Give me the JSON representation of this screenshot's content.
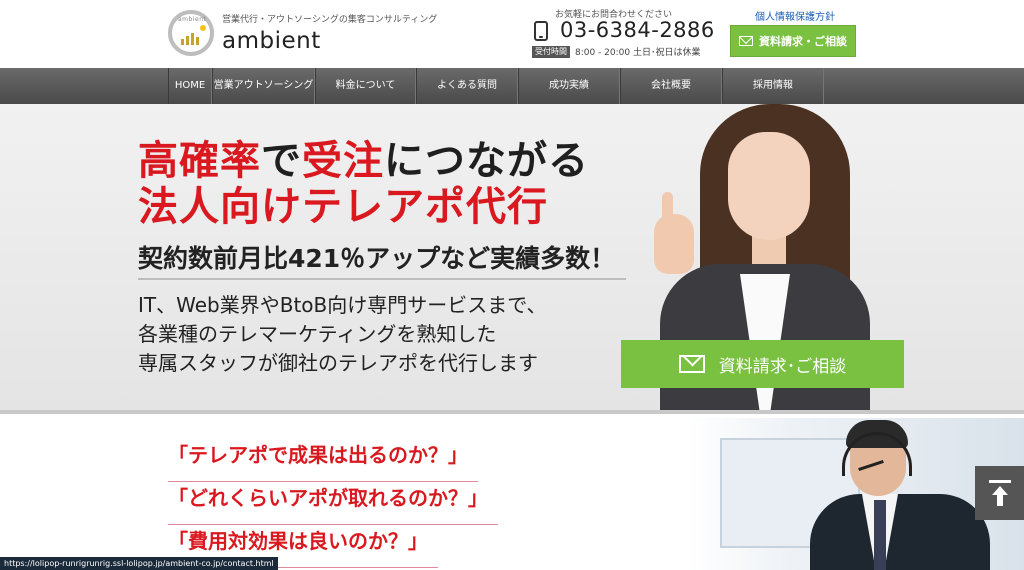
{
  "header": {
    "logo_mark_text": "ambient",
    "tagline": "営業代行・アウトソーシングの集客コンサルティング",
    "logo_word": "ambient",
    "contact_note": "お気軽にお問合わせください",
    "phone": "03-6384-2886",
    "hours_badge": "受付時間",
    "hours": "8:00 - 20:00 土日･祝日は休業",
    "privacy_link": "個人情報保護方針",
    "cta_label": "資料請求・ご相談"
  },
  "nav": {
    "items": [
      {
        "label": "HOME"
      },
      {
        "label": "営業アウトソーシング"
      },
      {
        "label": "料金について"
      },
      {
        "label": "よくある質問"
      },
      {
        "label": "成功実績"
      },
      {
        "label": "会社概要"
      },
      {
        "label": "採用情報"
      }
    ]
  },
  "hero": {
    "headline_a": "高確率",
    "headline_b": "で",
    "headline_c": "受注",
    "headline_d": "につながる",
    "headline2": "法人向けテレアポ代行",
    "sub_headline": "契約数前月比421％アップなど実績多数！",
    "body_line1": "IT、Web業界やBtoB向け専門サービスまで、",
    "body_line2": "各業種のテレマーケティングを熟知した",
    "body_line3": "専属スタッフが御社のテレアポを代行します",
    "cta_label": "資料請求･ご相談"
  },
  "questions": [
    "「テレアポで成果は出るのか？」",
    "「どれくらいアポが取れるのか？」",
    "「費用対効果は良いのか？」"
  ],
  "status_url": "https://lolipop-runrigrunrig.ssl-lolipop.jp/ambient-co.jp/contact.html",
  "colors": {
    "accent_green": "#7ac142",
    "accent_red": "#d9181f",
    "nav_gray": "#555555"
  }
}
